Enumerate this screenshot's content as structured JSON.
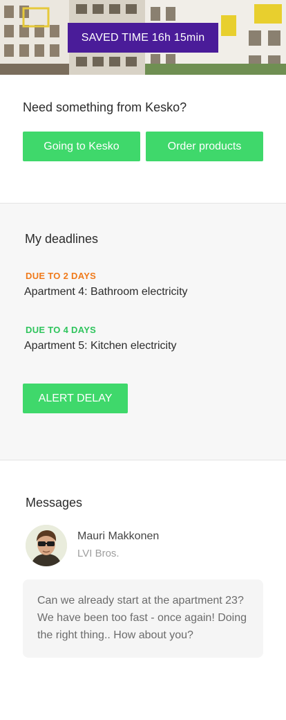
{
  "hero": {
    "saved_time_label": "SAVED TIME 16h 15min"
  },
  "kesko": {
    "title": "Need something from Kesko?",
    "going_button": "Going to Kesko",
    "order_button": "Order products"
  },
  "deadlines": {
    "title": "My deadlines",
    "items": [
      {
        "due": "DUE TO 2 DAYS",
        "due_color": "#f07a1a",
        "task": "Apartment 4: Bathroom electricity"
      },
      {
        "due": "DUE TO 4 DAYS",
        "due_color": "#2ec45c",
        "task": "Apartment 5: Kitchen electricity"
      }
    ],
    "alert_button": "ALERT DELAY"
  },
  "messages": {
    "title": "Messages",
    "sender": {
      "name": "Mauri Makkonen",
      "company": "LVI Bros."
    },
    "text": "Can we already start at the apartment 23? We have been too fast - once again! Doing the right thing.. How about you?"
  },
  "colors": {
    "accent_green": "#3fd86b",
    "badge_purple": "#4a1c99",
    "due_orange": "#f07a1a",
    "due_green": "#2ec45c"
  }
}
